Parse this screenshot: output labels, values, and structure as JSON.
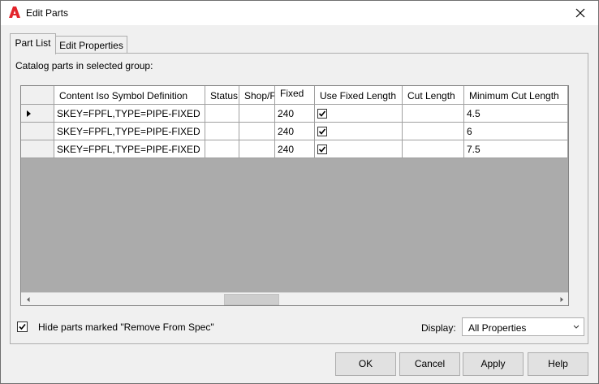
{
  "window": {
    "title": "Edit Parts"
  },
  "tabs": [
    {
      "label": "Part List",
      "active": true
    },
    {
      "label": "Edit Properties",
      "active": false
    }
  ],
  "catalog_label": "Catalog parts in selected group:",
  "grid": {
    "columns": [
      "Content Iso Symbol Definition",
      "Status",
      "Shop/F",
      "Fixed",
      "Use Fixed Length",
      "Cut Length",
      "Minimum Cut Length"
    ],
    "rows": [
      {
        "current": true,
        "iso": "SKEY=FPFL,TYPE=PIPE-FIXED",
        "status": "",
        "shop": "",
        "fixed": "240",
        "use_fixed_length": true,
        "cut_length": "",
        "min_cut_length": "4.5"
      },
      {
        "current": false,
        "iso": "SKEY=FPFL,TYPE=PIPE-FIXED",
        "status": "",
        "shop": "",
        "fixed": "240",
        "use_fixed_length": true,
        "cut_length": "",
        "min_cut_length": "6"
      },
      {
        "current": false,
        "iso": "SKEY=FPFL,TYPE=PIPE-FIXED",
        "status": "",
        "shop": "",
        "fixed": "240",
        "use_fixed_length": true,
        "cut_length": "",
        "min_cut_length": "7.5"
      }
    ]
  },
  "hide_parts": {
    "checked": true,
    "label": "Hide parts marked \"Remove From Spec\""
  },
  "display": {
    "label": "Display:",
    "value": "All Properties"
  },
  "buttons": {
    "ok": "OK",
    "cancel": "Cancel",
    "apply": "Apply",
    "help": "Help"
  },
  "icons": {
    "app": "autocad-logo-icon",
    "close": "close-icon"
  },
  "colors": {
    "brand": "#e3242b"
  }
}
